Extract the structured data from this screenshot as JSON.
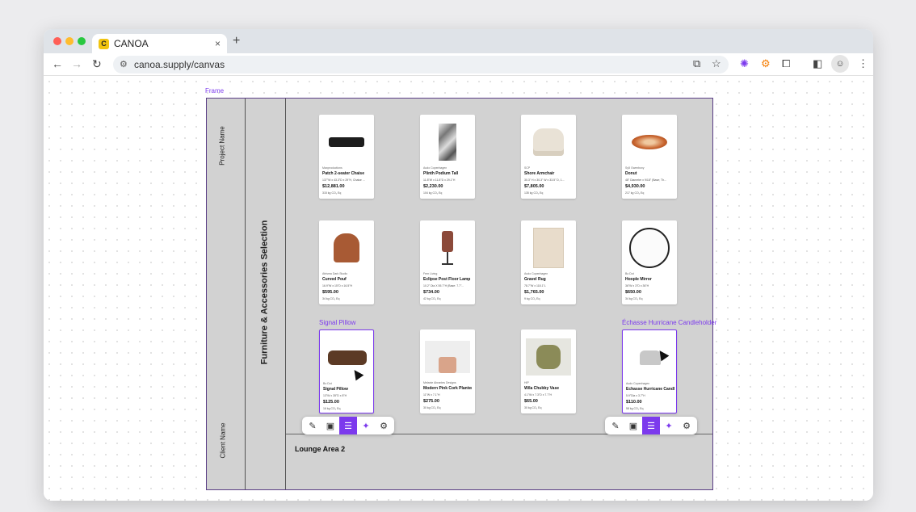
{
  "browser": {
    "tab_title": "CANOA",
    "tab_favicon_letter": "C",
    "new_tab_glyph": "+",
    "close_glyph": "×",
    "url": "canoa.supply/canvas",
    "traffic_light_colors": [
      "#ff5f57",
      "#febc2e",
      "#28c840"
    ]
  },
  "canvas": {
    "frame_label": "Frame",
    "project_name": "Project Name",
    "client_name": "Client Name",
    "section_title": "Furniture & Accessories  Selection",
    "next_section_label": "Lounge Area 2",
    "accent_color": "#7c3aed",
    "products": [
      {
        "brand": "Maxproductions",
        "name": "Patch 2-seater Chaise",
        "dims": "137\"W x 43.3\"D x 29\"H, Chaise ...",
        "price": "$12,881.00",
        "co2": "315 kg CO₂ Eq",
        "selected": false,
        "title": ""
      },
      {
        "brand": "Audo Copenhagen",
        "name": "Plinth Podium Tall",
        "dims": "11.8\"W x 11.8\"D x 29.1\"H",
        "price": "$2,230.00",
        "co2": "104 kg CO₂ Eq",
        "selected": false,
        "title": ""
      },
      {
        "brand": "SCP",
        "name": "Shore Armchair",
        "dims": "30.3\" H x 30.3\" W x 33.5\" D, 1...",
        "price": "$7,805.00",
        "co2": "135 kg CO₂ Eq",
        "selected": false,
        "title": ""
      },
      {
        "brand": "Sy5 Gwenboxy",
        "name": "Donut",
        "dims": "48\" Diameter x 9/18\" (Base; Th...",
        "price": "$4,930.00",
        "co2": "217 kg CO₂ Eq",
        "selected": false,
        "title": ""
      },
      {
        "brand": "Atrisma Dark Studio",
        "name": "Curved Pouf",
        "dims": "16.9\"W x 15\"D x 16.5\"H",
        "price": "$595.00",
        "co2": "34 kg CO₂ Eq",
        "selected": false,
        "title": ""
      },
      {
        "brand": "Fern Living",
        "name": "Eclipse Post Floor Lamp",
        "dims": "10.2\" Dia X 55.7\"H (Base: 7.7\"...",
        "price": "$734.00",
        "co2": "42 kg CO₂ Eq",
        "selected": false,
        "title": ""
      },
      {
        "brand": "Audo Copenhagen",
        "name": "Gravel Rug",
        "dims": "78.7\"W x 118.1\"L",
        "price": "$1,765.00",
        "co2": "9 kg CO₂ Eq",
        "selected": false,
        "title": ""
      },
      {
        "brand": "Bo Dot",
        "name": "Hoople Mirror",
        "dims": "36\"W x 3\"D x 36\"H",
        "price": "$650.00",
        "co2": "34 kg CO₂ Eq",
        "selected": false,
        "title": ""
      },
      {
        "brand": "Bo Dot",
        "name": "Signal Pillow",
        "dims": "13\"W x 35\"D x 8\"H",
        "price": "$125.00",
        "co2": "16 kg CO₂ Eq",
        "selected": true,
        "title": "Signal Pillow"
      },
      {
        "brand": "Melanie Abrantes Designs",
        "name": "Modern Pink Cork Planter",
        "dims": "11\"W x 7.1\"H",
        "price": "$275.00",
        "co2": "30 kg CO₂ Eq",
        "selected": false,
        "title": ""
      },
      {
        "brand": "HIP",
        "name": "Wila Chubby Vase",
        "dims": "4.1\"W x 7.3\"D x 7.7\"H",
        "price": "$65.00",
        "co2": "30 kg CO₂ Eq",
        "selected": false,
        "title": ""
      },
      {
        "brand": "Audo Copenhagen",
        "name": "Échasse Hurricane Candl...",
        "dims": "5.9\"Dia x 3.7\"H",
        "price": "$110.00",
        "co2": "58 kg CO₂ Eq",
        "selected": true,
        "title": "Échasse Hurricane Candleholder"
      }
    ],
    "card_toolbar_icons": [
      "edit-icon",
      "image-icon",
      "list-icon",
      "sparkle-icon",
      "gear-icon"
    ],
    "card_toolbar_glyphs": [
      "✎",
      "▣",
      "☰",
      "✦",
      "⚙"
    ]
  }
}
